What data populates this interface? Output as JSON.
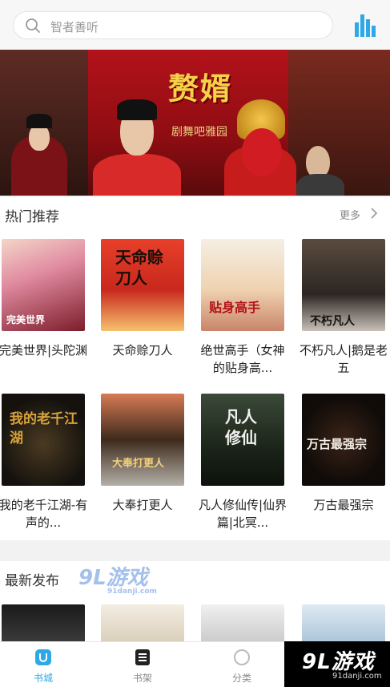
{
  "search": {
    "placeholder": "智者善听"
  },
  "banner": {
    "title": "赘婿",
    "subtitle": "剧舞吧雅园"
  },
  "hot": {
    "title": "热门推荐",
    "more": "更多",
    "books": [
      {
        "title": "完美世界|头陀渊",
        "cover_text": "完美世界"
      },
      {
        "title": "天命赊刀人",
        "cover_text": "天命赊刀人"
      },
      {
        "title": "绝世高手（女神的贴身高...",
        "cover_text": "贴身高手"
      },
      {
        "title": "不朽凡人|鹅是老五",
        "cover_text": "不朽凡人"
      },
      {
        "title": "我的老千江湖-有声的...",
        "cover_text": "我的老千江湖"
      },
      {
        "title": "大奉打更人",
        "cover_text": "大奉打更人"
      },
      {
        "title": "凡人修仙传|仙界篇|北冥...",
        "cover_text": "凡人修仙"
      },
      {
        "title": "万古最强宗",
        "cover_text": "万古最强宗"
      }
    ]
  },
  "latest": {
    "title": "最新发布"
  },
  "watermark": {
    "text": "9L游戏",
    "sub": "91danji.com"
  },
  "tabs": [
    {
      "label": "书城",
      "active": true
    },
    {
      "label": "书架",
      "active": false
    },
    {
      "label": "分类",
      "active": false
    }
  ],
  "logo": {
    "text": "9L游戏",
    "url": "91danji.com"
  },
  "colors": {
    "accent": "#2ea8e6",
    "banner": "#b3121a"
  }
}
